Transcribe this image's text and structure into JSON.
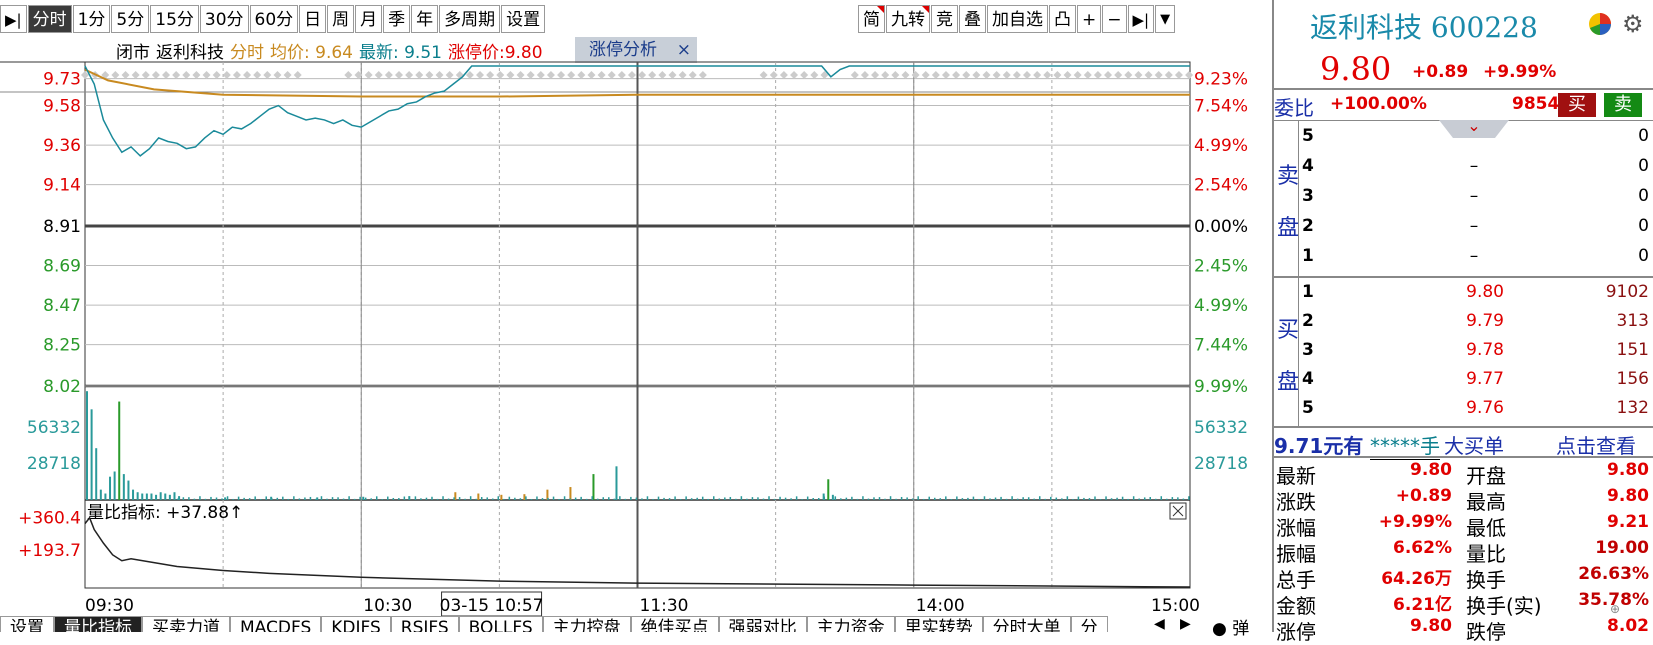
{
  "toolbar": {
    "left_icon": "collapse-right-icon",
    "period_tabs": [
      "分时",
      "1分",
      "5分",
      "15分",
      "30分",
      "60分",
      "日",
      "周",
      "月",
      "季",
      "年",
      "多周期",
      "设置"
    ],
    "active_tab": "分时",
    "right_buttons": [
      "简",
      "九转",
      "竞",
      "叠",
      "加自选",
      "凸",
      "+",
      "−"
    ],
    "right_icons": [
      "expand-icon",
      "dropdown-icon"
    ]
  },
  "chart_header": {
    "status": "闭市",
    "name": "返利科技",
    "mode": "分时",
    "avg_label": "均价: 9.64",
    "latest_label": "最新: 9.51",
    "limit_label": "涨停价:9.80"
  },
  "limit_tab": {
    "label": "涨停分析",
    "close": "×"
  },
  "colors": {
    "red": "#e00000",
    "green": "#2a9a2a",
    "price_line": "#1a8a9a",
    "avg_line": "#c88a20",
    "volume": "#2a9a9a"
  },
  "chart_data": [
    {
      "type": "line",
      "title": "",
      "x_ticks": [
        "09:30",
        "10:30",
        "11:30",
        "14:00",
        "15:00"
      ],
      "y_left_ticks": [
        "9.73",
        "9.58",
        "9.36",
        "9.14",
        "8.91",
        "8.69",
        "8.47",
        "8.25",
        "8.02"
      ],
      "y_right_ticks": [
        "9.23%",
        "7.54%",
        "4.99%",
        "2.54%",
        "0.00%",
        "2.45%",
        "4.99%",
        "7.44%",
        "9.99%"
      ],
      "prev_close": 8.91,
      "ylim": [
        8.02,
        9.8
      ],
      "series": [
        {
          "role": "price",
          "x_min": [
            0,
            2,
            4,
            6,
            8,
            10,
            12,
            14,
            16,
            18,
            20,
            22,
            24,
            26,
            28,
            30,
            32,
            34,
            36,
            38,
            40,
            42,
            44,
            46,
            48,
            50,
            52,
            54,
            56,
            58,
            60,
            62,
            64,
            66,
            68,
            70,
            72,
            74,
            76,
            78,
            80,
            82,
            84,
            86,
            88,
            90,
            92,
            94,
            96,
            98,
            100,
            102,
            104,
            106,
            108,
            110,
            112,
            114,
            116,
            118,
            120,
            150,
            160,
            162,
            164,
            166,
            170,
            180,
            200,
            240
          ],
          "values": [
            9.8,
            9.7,
            9.5,
            9.4,
            9.32,
            9.35,
            9.3,
            9.34,
            9.4,
            9.38,
            9.37,
            9.34,
            9.35,
            9.4,
            9.44,
            9.42,
            9.46,
            9.45,
            9.48,
            9.52,
            9.56,
            9.58,
            9.54,
            9.52,
            9.5,
            9.51,
            9.5,
            9.48,
            9.5,
            9.47,
            9.46,
            9.49,
            9.52,
            9.55,
            9.56,
            9.59,
            9.6,
            9.63,
            9.65,
            9.66,
            9.7,
            9.74,
            9.8,
            9.8,
            9.8,
            9.8,
            9.8,
            9.8,
            9.8,
            9.8,
            9.8,
            9.8,
            9.8,
            9.8,
            9.8,
            9.8,
            9.8,
            9.8,
            9.8,
            9.8,
            9.8,
            9.8,
            9.8,
            9.74,
            9.78,
            9.8,
            9.8,
            9.8,
            9.8,
            9.8
          ]
        },
        {
          "role": "avg",
          "x_min": [
            0,
            5,
            15,
            30,
            60,
            90,
            120,
            180,
            240
          ],
          "values": [
            9.78,
            9.72,
            9.67,
            9.64,
            9.63,
            9.63,
            9.64,
            9.64,
            9.64
          ]
        }
      ]
    },
    {
      "type": "bar",
      "title": "",
      "y_ticks": [
        "56332",
        "28718"
      ],
      "x_min": [
        0,
        1,
        2,
        3,
        4,
        5,
        6,
        7,
        8,
        9,
        10,
        11,
        12,
        13,
        14,
        15,
        16,
        17,
        18,
        19,
        20,
        30,
        40,
        50,
        60,
        70,
        80,
        85,
        90,
        95,
        100,
        105,
        110,
        115,
        160,
        161,
        162
      ],
      "values": [
        84000,
        70000,
        40000,
        8000,
        5000,
        18000,
        22000,
        76000,
        20000,
        15000,
        8000,
        6000,
        5000,
        5000,
        5000,
        4000,
        6000,
        5000,
        4000,
        6000,
        3000,
        2000,
        2500,
        2000,
        2500,
        3000,
        6000,
        5000,
        4000,
        4500,
        8000,
        10000,
        20000,
        26000,
        5000,
        16000,
        4000
      ]
    },
    {
      "type": "line",
      "title": "量比指标: +37.88↑",
      "y_ticks": [
        "+360.4",
        "+193.7"
      ],
      "x_min": [
        0,
        1,
        2,
        4,
        6,
        8,
        10,
        15,
        20,
        30,
        40,
        60,
        90,
        120,
        180,
        240
      ],
      "values": [
        330,
        360,
        300,
        230,
        170,
        140,
        150,
        130,
        110,
        90,
        75,
        55,
        35,
        25,
        15,
        5
      ]
    }
  ],
  "cursor": {
    "time_label": "03-15 10:57"
  },
  "quote": {
    "name": "返利科技",
    "code": "600228",
    "price": "9.80",
    "change": "+0.89",
    "change_pct": "+9.99%",
    "wei_label": "委比",
    "wei_pct": "+100.00%",
    "wei_diff": "9854",
    "buy_btn": "买",
    "sell_btn": "卖",
    "sell_side_label": [
      "卖",
      "盘"
    ],
    "buy_side_label": [
      "买",
      "盘"
    ],
    "sell": [
      {
        "lvl": "5",
        "price": "",
        "vol": "0"
      },
      {
        "lvl": "4",
        "price": "–",
        "vol": "0"
      },
      {
        "lvl": "3",
        "price": "–",
        "vol": "0"
      },
      {
        "lvl": "2",
        "price": "–",
        "vol": "0"
      },
      {
        "lvl": "1",
        "price": "–",
        "vol": "0"
      }
    ],
    "buy": [
      {
        "lvl": "1",
        "price": "9.80",
        "vol": "9102"
      },
      {
        "lvl": "2",
        "price": "9.79",
        "vol": "313"
      },
      {
        "lvl": "3",
        "price": "9.78",
        "vol": "151"
      },
      {
        "lvl": "4",
        "price": "9.77",
        "vol": "156"
      },
      {
        "lvl": "5",
        "price": "9.76",
        "vol": "132"
      }
    ],
    "big_order": {
      "price": "9.71元有",
      "mask": "*****手",
      "label": "大买单",
      "link": "点击查看"
    },
    "stats": [
      {
        "k1": "最新",
        "v1": "9.80",
        "k2": "开盘",
        "v2": "9.80"
      },
      {
        "k1": "涨跌",
        "v1": "+0.89",
        "k2": "最高",
        "v2": "9.80"
      },
      {
        "k1": "涨幅",
        "v1": "+9.99%",
        "k2": "最低",
        "v2": "9.21"
      },
      {
        "k1": "振幅",
        "v1": "6.62%",
        "k2": "量比",
        "v2": "19.00"
      },
      {
        "k1": "总手",
        "v1": "64.26万",
        "k2": "换手",
        "v2": "26.63%"
      },
      {
        "k1": "金额",
        "v1": "6.21亿",
        "k2": "换手(实)",
        "v2": "35.78%"
      },
      {
        "k1": "涨停",
        "v1": "9.80",
        "k2": "跌停",
        "v2": "8.02"
      }
    ]
  },
  "bottom_tabs": [
    "设置",
    "量比指标",
    "买卖力道",
    "MACDFS",
    "KDJFS",
    "RSIFS",
    "BOLLFS",
    "主力控盘",
    "绝佳买点",
    "强弱对比",
    "主力资金",
    "里实转势",
    "分时大单",
    "分"
  ],
  "bottom_active": "量比指标",
  "bottom_right": "弹"
}
